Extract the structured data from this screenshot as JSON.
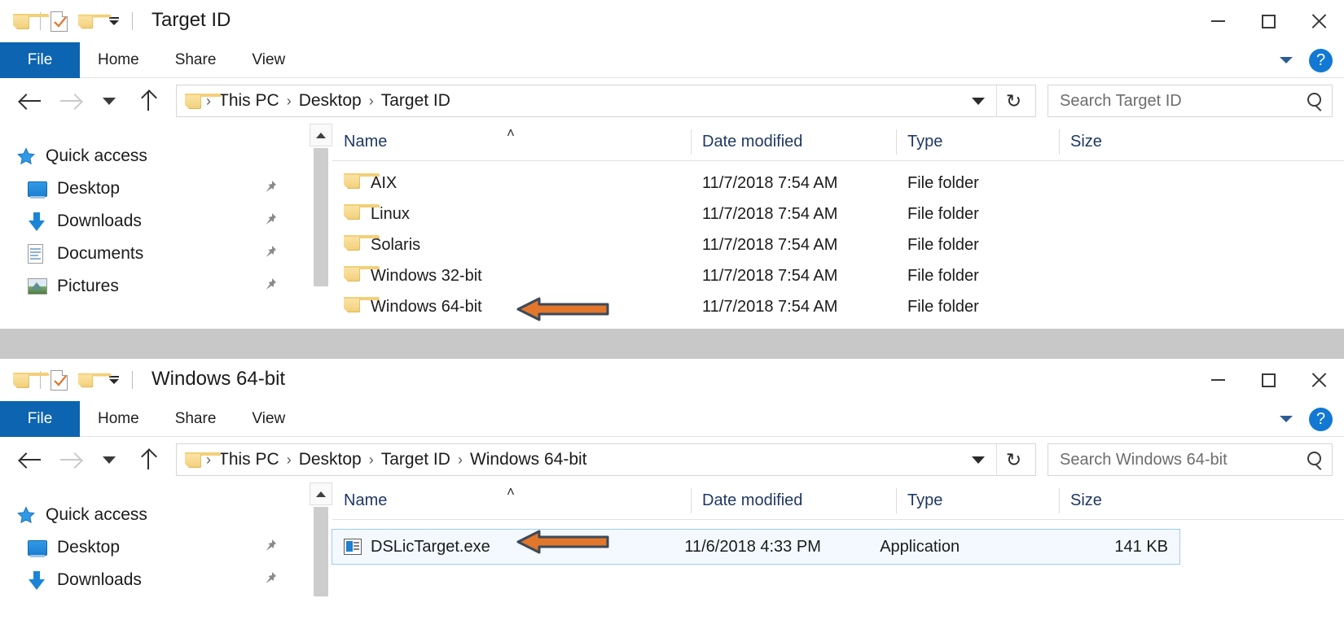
{
  "windows": [
    {
      "id": "target-id-window",
      "title": "Target ID",
      "quick_access_toolbar": {
        "icons": [
          "folder-icon",
          "properties-icon",
          "new-folder-icon",
          "customize-dropdown-icon"
        ]
      },
      "window_controls": {
        "minimize": "minimize-icon",
        "maximize": "maximize-icon",
        "close": "close-icon"
      },
      "ribbon": {
        "tabs": [
          {
            "label": "File",
            "active": true
          },
          {
            "label": "Home",
            "active": false
          },
          {
            "label": "Share",
            "active": false
          },
          {
            "label": "View",
            "active": false
          }
        ],
        "expand_label": "⌄",
        "help_label": "?"
      },
      "address": {
        "back": "back-arrow-icon",
        "forward": "forward-arrow-icon",
        "recent": "recent-locations-icon",
        "up": "up-one-level-icon",
        "breadcrumbs": [
          "This PC",
          "Desktop",
          "Target ID"
        ],
        "separator": "›",
        "dropdown": "previous-locations-icon",
        "refresh": "↻"
      },
      "search": {
        "placeholder": "Search Target ID",
        "icon": "search-icon"
      },
      "sidebar": {
        "items": [
          {
            "label": "Quick access",
            "icon": "star-icon",
            "pinned": false,
            "root": true
          },
          {
            "label": "Desktop",
            "icon": "monitor-icon",
            "pinned": true,
            "root": false
          },
          {
            "label": "Downloads",
            "icon": "download-arrow-icon",
            "pinned": true,
            "root": false
          },
          {
            "label": "Documents",
            "icon": "document-icon",
            "pinned": true,
            "root": false
          },
          {
            "label": "Pictures",
            "icon": "picture-icon",
            "pinned": true,
            "root": false
          }
        ]
      },
      "columns": [
        "Name",
        "Date modified",
        "Type",
        "Size"
      ],
      "sort_indicator": "˄",
      "files": [
        {
          "name": "AIX",
          "date": "11/7/2018 7:54 AM",
          "type": "File folder",
          "size": "",
          "icon": "folder-icon",
          "selected": false
        },
        {
          "name": "Linux",
          "date": "11/7/2018 7:54 AM",
          "type": "File folder",
          "size": "",
          "icon": "folder-icon",
          "selected": false
        },
        {
          "name": "Solaris",
          "date": "11/7/2018 7:54 AM",
          "type": "File folder",
          "size": "",
          "icon": "folder-icon",
          "selected": false
        },
        {
          "name": "Windows 32-bit",
          "date": "11/7/2018 7:54 AM",
          "type": "File folder",
          "size": "",
          "icon": "folder-icon",
          "selected": false
        },
        {
          "name": "Windows 64-bit",
          "date": "11/7/2018 7:54 AM",
          "type": "File folder",
          "size": "",
          "icon": "folder-icon",
          "selected": false
        }
      ]
    },
    {
      "id": "windows-64-bit-window",
      "title": "Windows 64-bit",
      "quick_access_toolbar": {
        "icons": [
          "folder-icon",
          "properties-icon",
          "new-folder-icon",
          "customize-dropdown-icon"
        ]
      },
      "window_controls": {
        "minimize": "minimize-icon",
        "maximize": "maximize-icon",
        "close": "close-icon"
      },
      "ribbon": {
        "tabs": [
          {
            "label": "File",
            "active": true
          },
          {
            "label": "Home",
            "active": false
          },
          {
            "label": "Share",
            "active": false
          },
          {
            "label": "View",
            "active": false
          }
        ],
        "expand_label": "⌄",
        "help_label": "?"
      },
      "address": {
        "back": "back-arrow-icon",
        "forward": "forward-arrow-icon",
        "recent": "recent-locations-icon",
        "up": "up-one-level-icon",
        "breadcrumbs": [
          "This PC",
          "Desktop",
          "Target ID",
          "Windows 64-bit"
        ],
        "separator": "›",
        "dropdown": "previous-locations-icon",
        "refresh": "↻"
      },
      "search": {
        "placeholder": "Search Windows 64-bit",
        "icon": "search-icon"
      },
      "sidebar": {
        "items": [
          {
            "label": "Quick access",
            "icon": "star-icon",
            "pinned": false,
            "root": true
          },
          {
            "label": "Desktop",
            "icon": "monitor-icon",
            "pinned": true,
            "root": false
          },
          {
            "label": "Downloads",
            "icon": "download-arrow-icon",
            "pinned": true,
            "root": false
          }
        ]
      },
      "columns": [
        "Name",
        "Date modified",
        "Type",
        "Size"
      ],
      "sort_indicator": "˄",
      "files": [
        {
          "name": "DSLicTarget.exe",
          "date": "11/6/2018 4:33 PM",
          "type": "Application",
          "size": "141 KB",
          "icon": "application-exe-icon",
          "selected": true
        }
      ]
    }
  ],
  "annotations": [
    {
      "name": "arrow-pointing-to-windows-64-bit",
      "color": "#E2762B",
      "outline": "#3B4A5A"
    },
    {
      "name": "arrow-pointing-to-dslictarget-exe",
      "color": "#E2762B",
      "outline": "#3B4A5A"
    }
  ],
  "colors": {
    "file_tab_blue": "#0D64B0",
    "header_text_blue": "#1F3864",
    "accent_orange": "#E2762B",
    "selection_fill": "#F3F9FF",
    "selection_border": "#9CCDF0",
    "gap_band": "#C8C8C8"
  }
}
